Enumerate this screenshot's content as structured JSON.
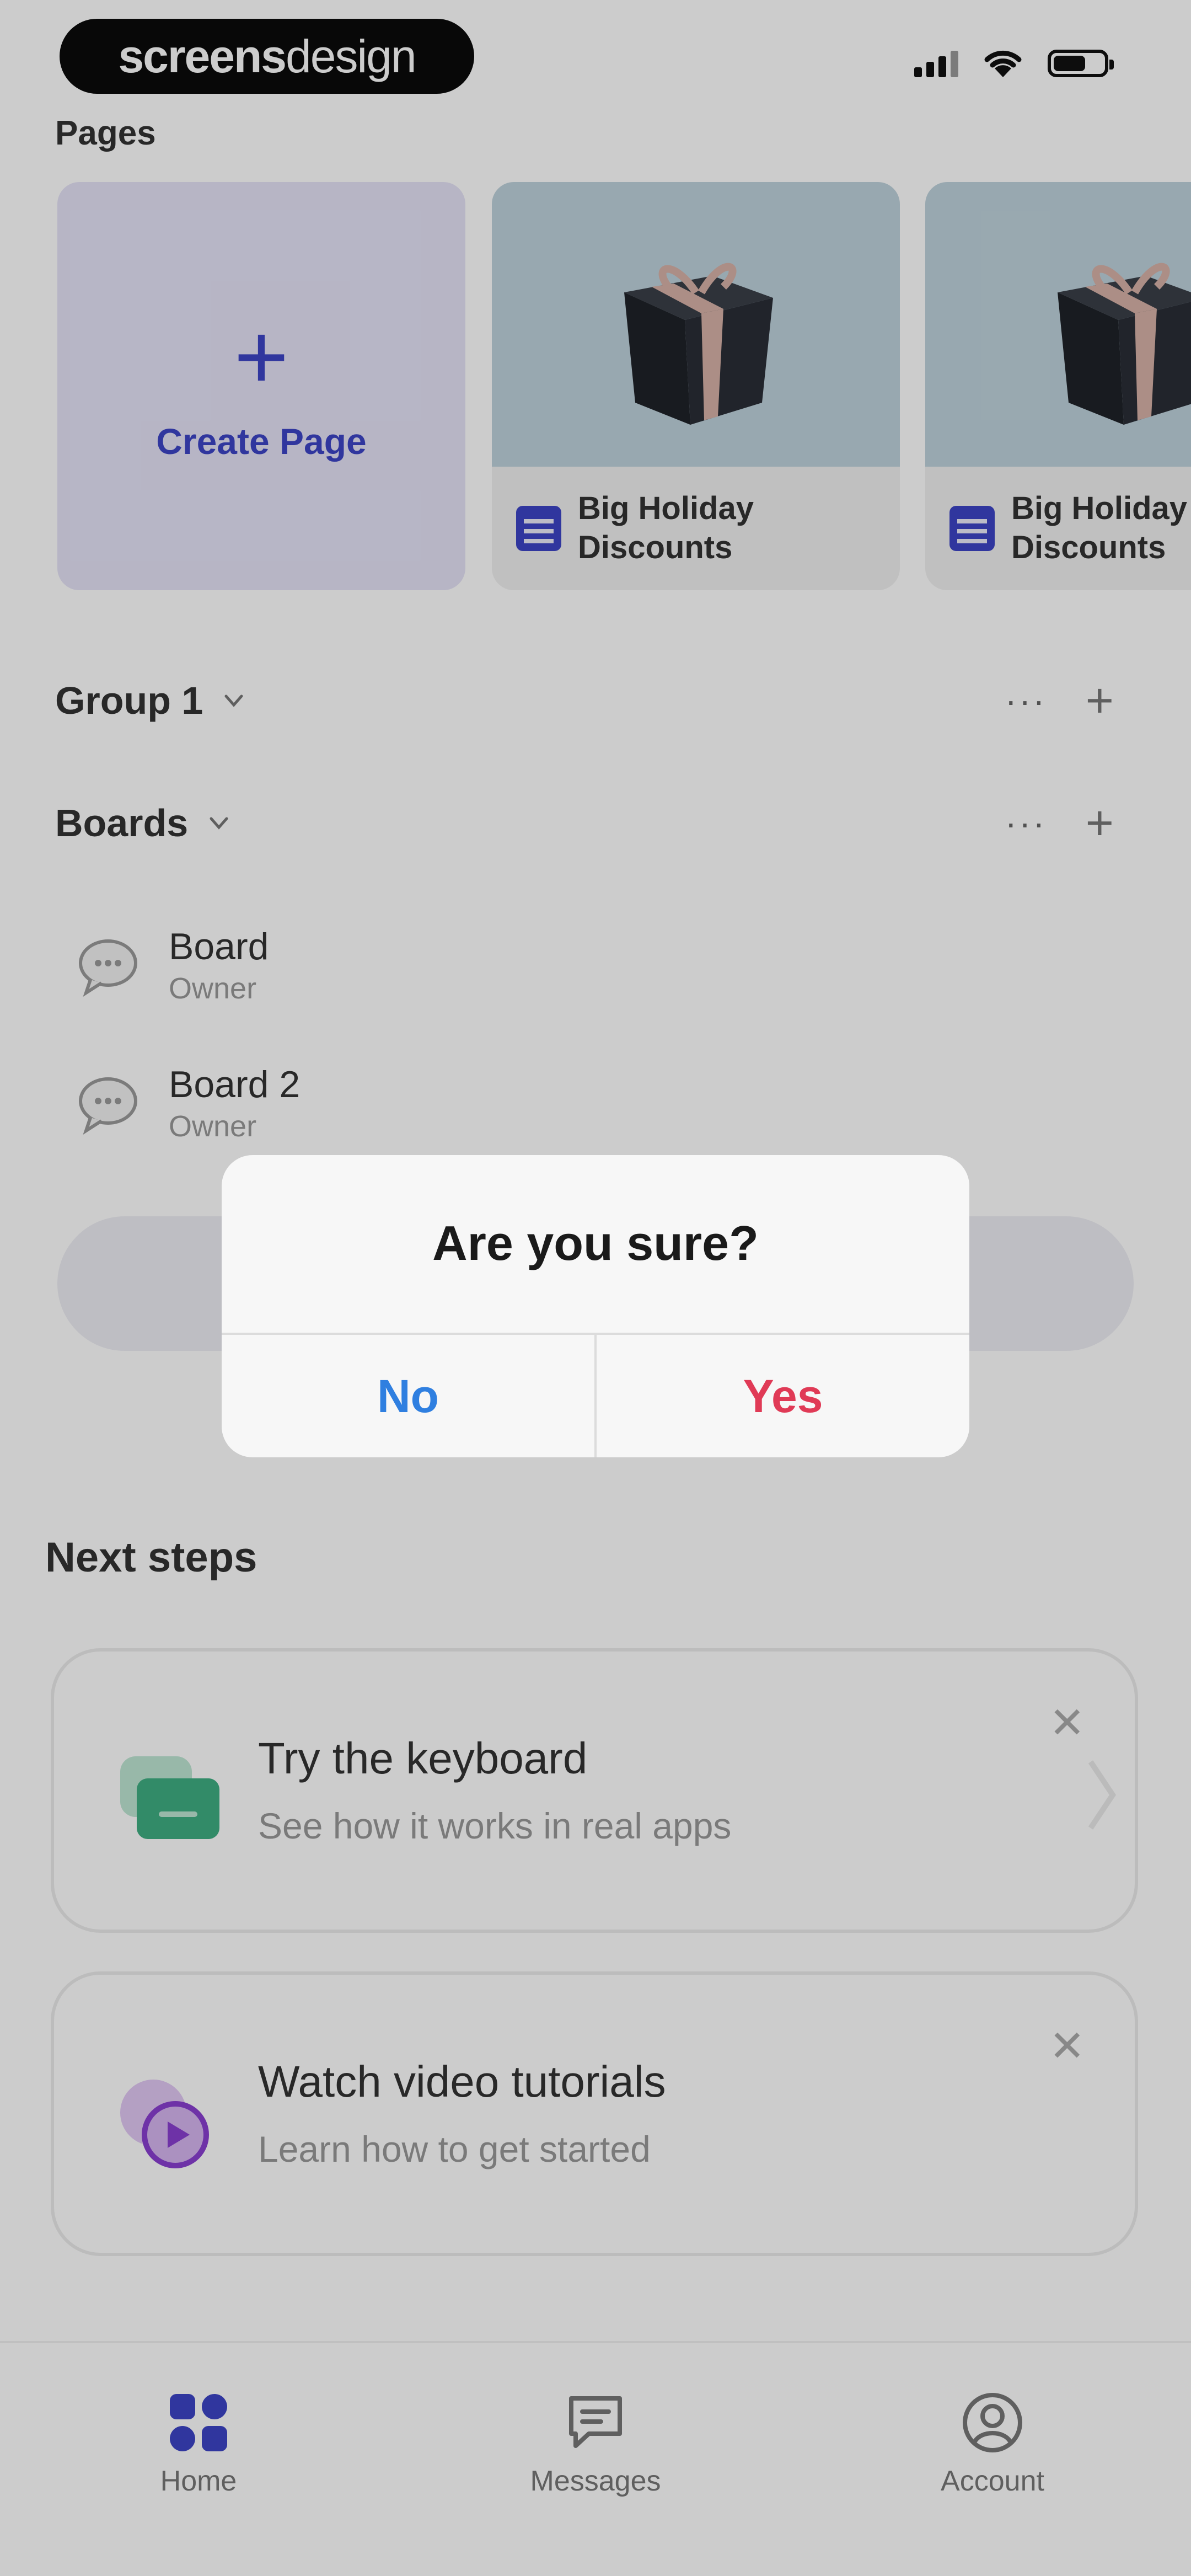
{
  "status_bar": {
    "brand_bold": "screens",
    "brand_light": "design"
  },
  "pages": {
    "label": "Pages",
    "create_label": "Create Page",
    "cards": [
      {
        "title_line1": "Big Holiday",
        "title_line2": "Discounts"
      },
      {
        "title_line1": "Big Holiday",
        "title_line2": "Discounts"
      }
    ]
  },
  "sections": {
    "group": {
      "name": "Group 1"
    },
    "boards": {
      "name": "Boards"
    }
  },
  "boards": [
    {
      "name": "Board",
      "role": "Owner"
    },
    {
      "name": "Board 2",
      "role": "Owner"
    }
  ],
  "next_steps": {
    "title": "Next steps",
    "items": [
      {
        "title": "Try the keyboard",
        "subtitle": "See how it works in real apps",
        "icon": "keyboard-icon",
        "color": "#3fae82"
      },
      {
        "title": "Watch video tutorials",
        "subtitle": "Learn how to get started",
        "icon": "video-play-icon",
        "color": "#8a3fd1"
      }
    ]
  },
  "bottom_nav": {
    "tabs": [
      {
        "label": "Home",
        "icon": "home-grid-icon",
        "active": true
      },
      {
        "label": "Messages",
        "icon": "message-icon",
        "active": false
      },
      {
        "label": "Account",
        "icon": "account-icon",
        "active": false
      }
    ]
  },
  "dialog": {
    "title": "Are you sure?",
    "no_label": "No",
    "yes_label": "Yes"
  },
  "colors": {
    "accent": "#3c44c6",
    "no": "#2f7fe0",
    "yes": "#e03a56"
  }
}
